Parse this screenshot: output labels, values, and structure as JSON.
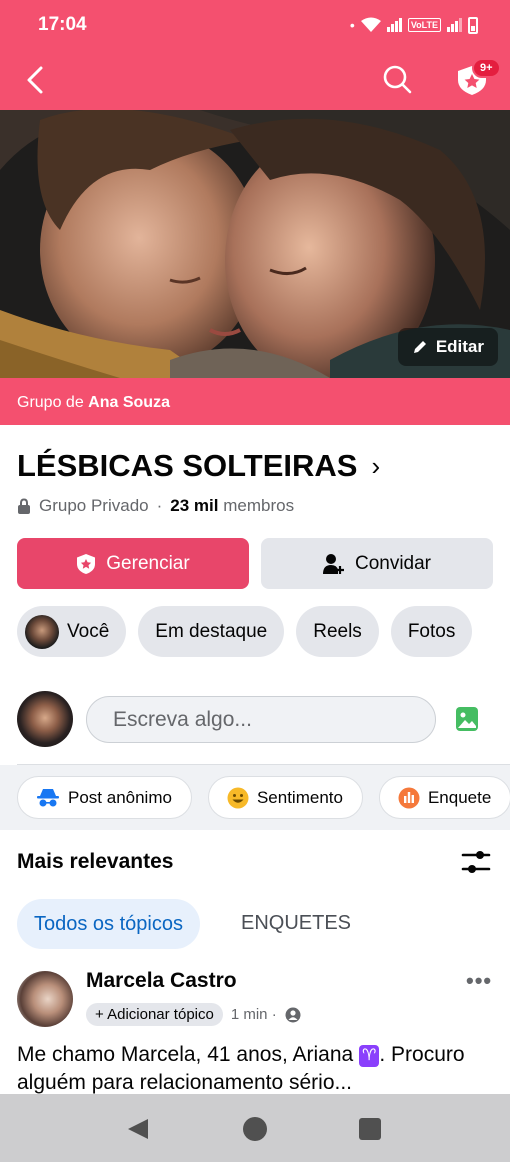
{
  "status_bar": {
    "time": "17:04",
    "volte": "VoLTE"
  },
  "app_bar": {
    "notifications_badge": "9+"
  },
  "cover": {
    "edit_label": "Editar"
  },
  "group": {
    "by_prefix": "Grupo de",
    "owner": "Ana Souza",
    "title": "LÉSBICAS SOLTEIRAS",
    "privacy": "Grupo Privado",
    "members_count": "23 mil",
    "members_label": "membros"
  },
  "actions": {
    "manage_label": "Gerenciar",
    "invite_label": "Convidar"
  },
  "chips": [
    "Você",
    "Em destaque",
    "Reels",
    "Fotos"
  ],
  "composer": {
    "placeholder": "Escreva algo..."
  },
  "post_options": [
    "Post anônimo",
    "Sentimento",
    "Enquete"
  ],
  "feed": {
    "sort_title": "Mais relevantes",
    "tabs": [
      "Todos os tópicos",
      "ENQUETES"
    ]
  },
  "post": {
    "author": "Marcela Castro",
    "add_topic": "Adicionar tópico",
    "time": "1 min ·",
    "text": "Me chamo Marcela, 41 anos, Ariana",
    "emoji": "♈",
    "text_after": ". Procuro alguém para relacionamento sério..."
  },
  "colors": {
    "brand": "#f4506f",
    "manage_button": "#e8466a",
    "active_tab": "#0a66c2"
  }
}
